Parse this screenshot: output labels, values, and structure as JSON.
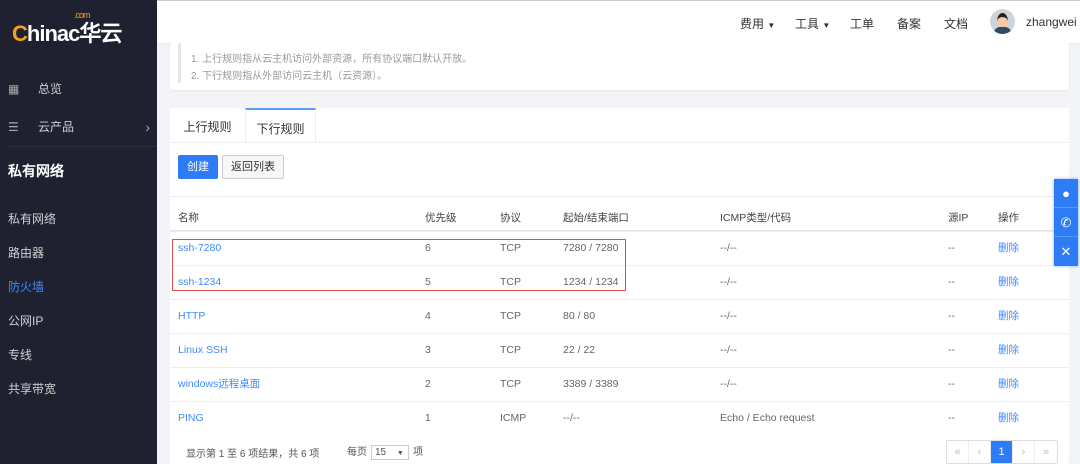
{
  "logo": {
    "text_a": "C",
    "text_b": "hinac华云",
    "com": ".com"
  },
  "sidebar": {
    "items": [
      {
        "label": "总览",
        "icon": "grid-icon"
      },
      {
        "label": "云产品",
        "icon": "menu-icon"
      }
    ],
    "section": "私有网络",
    "sub": [
      "私有网络",
      "路由器",
      "防火墙",
      "公网IP",
      "专线",
      "共享带宽"
    ]
  },
  "header": {
    "nav": [
      "费用",
      "工具",
      "工单",
      "备案",
      "文档"
    ],
    "user": "zhangwei"
  },
  "notice": [
    "1. 上行规则指从云主机访问外部资源，所有协议端口默认开放。",
    "2. 下行规则指从外部访问云主机（云资源）。"
  ],
  "tabs": [
    "上行规则",
    "下行规则"
  ],
  "buttons": {
    "create": "创建",
    "back": "返回列表"
  },
  "table": {
    "headers": [
      "名称",
      "优先级",
      "协议",
      "起始/结束端口",
      "ICMP类型/代码",
      "源IP",
      "操作"
    ],
    "rows": [
      [
        "ssh-7280",
        "6",
        "TCP",
        "7280 / 7280",
        "--/--",
        "--",
        "删除"
      ],
      [
        "ssh-1234",
        "5",
        "TCP",
        "1234 / 1234",
        "--/--",
        "--",
        "删除"
      ],
      [
        "HTTP",
        "4",
        "TCP",
        "80 / 80",
        "--/--",
        "--",
        "删除"
      ],
      [
        "Linux SSH",
        "3",
        "TCP",
        "22 / 22",
        "--/--",
        "--",
        "删除"
      ],
      [
        "windows远程桌面",
        "2",
        "TCP",
        "3389 / 3389",
        "--/--",
        "--",
        "删除"
      ],
      [
        "PING",
        "1",
        "ICMP",
        "--/--",
        "Echo / Echo request",
        "--",
        "删除"
      ]
    ]
  },
  "footer": {
    "summary": "显示第 1 至 6 项结果，共 6 项",
    "per_page": "每页",
    "per_value": "15",
    "unit": "项"
  },
  "pager": [
    "«",
    "‹",
    "1",
    "›",
    "»"
  ],
  "float": [
    "qq-icon",
    "phone-icon",
    "close-icon"
  ]
}
